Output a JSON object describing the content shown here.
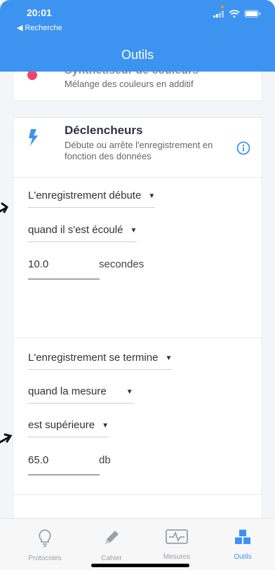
{
  "status": {
    "time": "20:01",
    "back": "◀ Recherche"
  },
  "header": {
    "title": "Outils"
  },
  "top_card": {
    "title": "Synthétiseur de couleurs",
    "subtitle": "Mélange des couleurs en additif"
  },
  "triggers": {
    "title": "Déclencheurs",
    "description": "Débute ou arrête l'enregistrement en fonction des données",
    "start": {
      "mode": "L'enregistrement débute",
      "condition": "quand il s'est écoulé",
      "value": "10.0",
      "unit": "secondes"
    },
    "stop": {
      "mode": "L'enregistrement se termine",
      "condition": "quand la mesure",
      "comparison": "est supérieure",
      "value": "65.0",
      "unit": "db"
    }
  },
  "tabs": [
    {
      "label": "Protocoles",
      "icon": "lightbulb-icon"
    },
    {
      "label": "Cahier",
      "icon": "pencil-icon"
    },
    {
      "label": "Mesures",
      "icon": "chart-icon"
    },
    {
      "label": "Outils",
      "icon": "cubes-icon"
    }
  ],
  "colors": {
    "accent": "#3d93f0",
    "background": "#f3f5f8"
  }
}
